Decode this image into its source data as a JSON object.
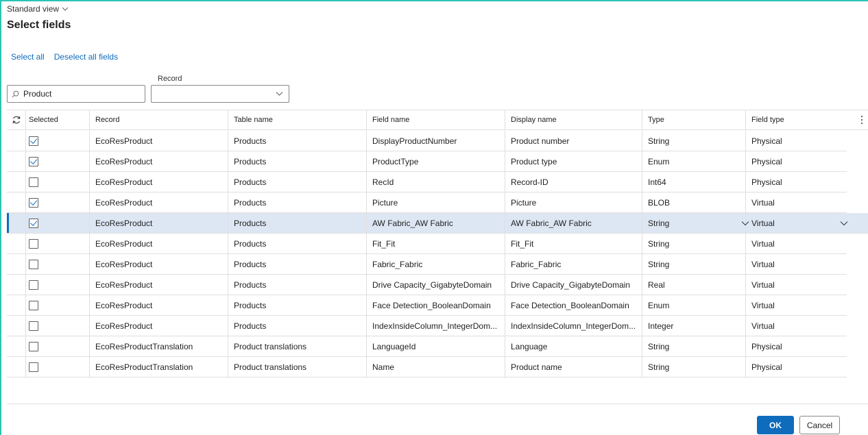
{
  "header": {
    "view_label": "Standard view",
    "title": "Select fields"
  },
  "actions": {
    "select_all": "Select all",
    "deselect_all": "Deselect all fields"
  },
  "filters": {
    "search_value": "Product",
    "record_label": "Record",
    "record_value": ""
  },
  "grid": {
    "columns": [
      "Selected",
      "Record",
      "Table name",
      "Field name",
      "Display name",
      "Type",
      "Field type"
    ],
    "rows": [
      {
        "selected": true,
        "record": "EcoResProduct",
        "table": "Products",
        "field": "DisplayProductNumber",
        "display": "Product number",
        "type": "String",
        "field_type": "Physical"
      },
      {
        "selected": true,
        "record": "EcoResProduct",
        "table": "Products",
        "field": "ProductType",
        "display": "Product type",
        "type": "Enum",
        "field_type": "Physical"
      },
      {
        "selected": false,
        "record": "EcoResProduct",
        "table": "Products",
        "field": "RecId",
        "display": "Record-ID",
        "type": "Int64",
        "field_type": "Physical"
      },
      {
        "selected": true,
        "record": "EcoResProduct",
        "table": "Products",
        "field": "Picture",
        "display": "Picture",
        "type": "BLOB",
        "field_type": "Virtual"
      },
      {
        "selected": true,
        "record": "EcoResProduct",
        "table": "Products",
        "field": "AW Fabric_AW Fabric",
        "display": "AW Fabric_AW Fabric",
        "type": "String",
        "field_type": "Virtual",
        "active": true
      },
      {
        "selected": false,
        "record": "EcoResProduct",
        "table": "Products",
        "field": "Fit_Fit",
        "display": "Fit_Fit",
        "type": "String",
        "field_type": "Virtual"
      },
      {
        "selected": false,
        "record": "EcoResProduct",
        "table": "Products",
        "field": "Fabric_Fabric",
        "display": "Fabric_Fabric",
        "type": "String",
        "field_type": "Virtual"
      },
      {
        "selected": false,
        "record": "EcoResProduct",
        "table": "Products",
        "field": "Drive Capacity_GigabyteDomain",
        "display": "Drive Capacity_GigabyteDomain",
        "type": "Real",
        "field_type": "Virtual"
      },
      {
        "selected": false,
        "record": "EcoResProduct",
        "table": "Products",
        "field": "Face Detection_BooleanDomain",
        "display": "Face Detection_BooleanDomain",
        "type": "Enum",
        "field_type": "Virtual"
      },
      {
        "selected": false,
        "record": "EcoResProduct",
        "table": "Products",
        "field": "IndexInsideColumn_IntegerDom...",
        "display": "IndexInsideColumn_IntegerDom...",
        "type": "Integer",
        "field_type": "Virtual"
      },
      {
        "selected": false,
        "record": "EcoResProductTranslation",
        "table": "Product translations",
        "field": "LanguageId",
        "display": "Language",
        "type": "String",
        "field_type": "Physical"
      },
      {
        "selected": false,
        "record": "EcoResProductTranslation",
        "table": "Product translations",
        "field": "Name",
        "display": "Product name",
        "type": "String",
        "field_type": "Physical"
      }
    ]
  },
  "footer": {
    "ok_label": "OK",
    "cancel_label": "Cancel"
  },
  "colors": {
    "accent": "#0f6cbd",
    "selected_row": "#dde7f4",
    "frame": "#2bc4b5"
  },
  "icons": [
    "chevron-down-icon",
    "search-icon",
    "refresh-icon",
    "more-icon",
    "checkbox-icon"
  ]
}
